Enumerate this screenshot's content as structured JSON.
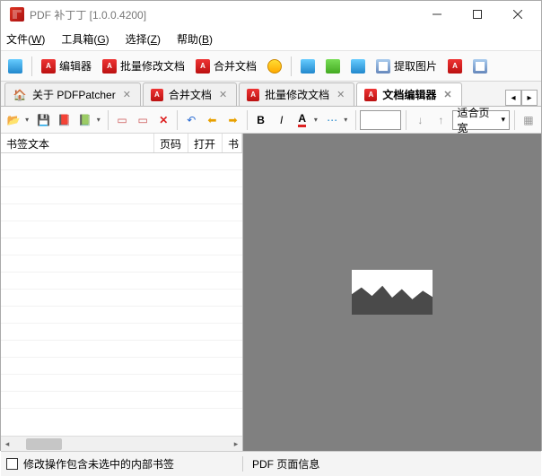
{
  "titlebar": {
    "title": "PDF 补丁丁 [1.0.0.4200]"
  },
  "menubar": {
    "file": "文件(W)",
    "toolbox": "工具箱(G)",
    "select": "选择(Z)",
    "help": "帮助(B)"
  },
  "toolbar": {
    "editor": "编辑器",
    "batch": "批量修改文档",
    "merge": "合并文档",
    "extract": "提取图片"
  },
  "tabs": {
    "about": "关于 PDFPatcher",
    "merge": "合并文档",
    "batch": "批量修改文档",
    "doceditor": "文档编辑器"
  },
  "grid": {
    "col_text": "书签文本",
    "col_page": "页码",
    "col_open": "打开",
    "col_bk": "书"
  },
  "zoom_label": "适合页宽",
  "status": {
    "left": "修改操作包含未选中的内部书签",
    "right": "PDF 页面信息"
  },
  "edit": {
    "bold": "B",
    "italic": "I"
  }
}
